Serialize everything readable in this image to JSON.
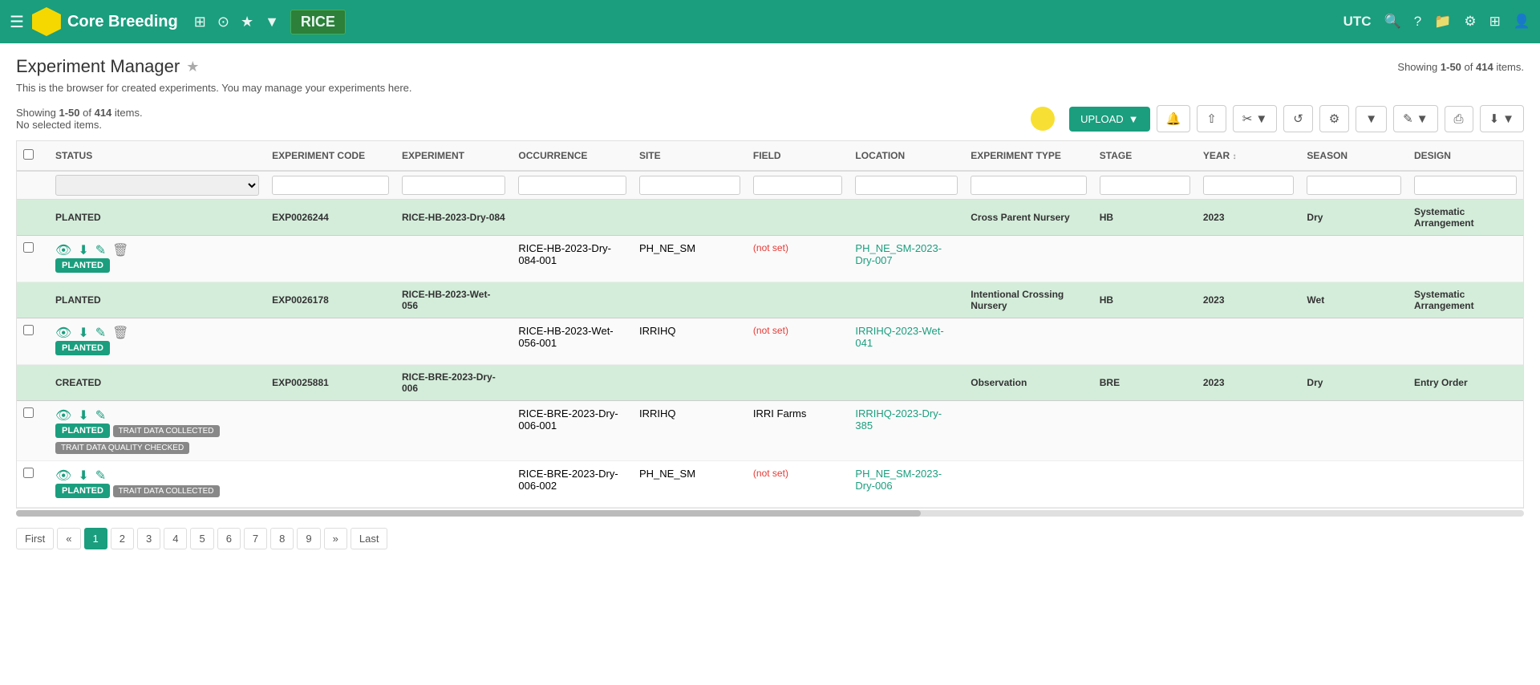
{
  "app": {
    "title": "Core Breeding",
    "filter_label": "RICE",
    "utc_label": "UTC"
  },
  "page": {
    "title": "Experiment Manager",
    "subtitle": "This is the browser for created experiments. You may manage your experiments here.",
    "subtitle_link": "here",
    "showing_text": "Showing",
    "showing_range": "1-50",
    "showing_of": "of",
    "showing_count": "414",
    "showing_items": "items.",
    "selected_items": "No selected items.",
    "showing_right": "Showing 1-50 of 414 items."
  },
  "toolbar": {
    "upload_label": "UPLOAD",
    "bell_icon": "🔔",
    "share_icon": "⇧",
    "tools_icon": "⚙",
    "refresh_icon": "↺",
    "settings_icon": "⚙",
    "filter_icon": "▼",
    "edit_icon": "✎",
    "print_icon": "⎙",
    "download_icon": "⬇"
  },
  "table": {
    "columns": [
      {
        "id": "checkbox",
        "label": ""
      },
      {
        "id": "status",
        "label": "STATUS"
      },
      {
        "id": "exp_code",
        "label": "EXPERIMENT CODE"
      },
      {
        "id": "experiment",
        "label": "EXPERIMENT"
      },
      {
        "id": "occurrence",
        "label": "OCCURRENCE"
      },
      {
        "id": "site",
        "label": "SITE"
      },
      {
        "id": "field",
        "label": "FIELD"
      },
      {
        "id": "location",
        "label": "LOCATION"
      },
      {
        "id": "exp_type",
        "label": "EXPERIMENT TYPE"
      },
      {
        "id": "stage",
        "label": "STAGE"
      },
      {
        "id": "year",
        "label": "YEAR"
      },
      {
        "id": "season",
        "label": "SEASON"
      },
      {
        "id": "design",
        "label": "DESIGN"
      }
    ],
    "groups": [
      {
        "status_label": "PLANTED",
        "exp_code": "EXP0026244",
        "experiment": "RICE-HB-2023-Dry-084",
        "exp_type": "Cross Parent Nursery",
        "stage": "HB",
        "year": "2023",
        "season": "Dry",
        "design": "Systematic Arrangement",
        "rows": [
          {
            "checkbox": false,
            "status": "PLANTED",
            "tags": [],
            "occurrence": "RICE-HB-2023-Dry-084-001",
            "site": "PH_NE_SM",
            "field": "(not set)",
            "location": "PH_NE_SM-2023-Dry-007",
            "has_delete": true
          }
        ]
      },
      {
        "status_label": "PLANTED",
        "exp_code": "EXP0026178",
        "experiment": "RICE-HB-2023-Wet-056",
        "exp_type": "Intentional Crossing Nursery",
        "stage": "HB",
        "year": "2023",
        "season": "Wet",
        "design": "Systematic Arrangement",
        "rows": [
          {
            "checkbox": false,
            "status": "PLANTED",
            "tags": [],
            "occurrence": "RICE-HB-2023-Wet-056-001",
            "site": "IRRIHQ",
            "field": "(not set)",
            "location": "IRRIHQ-2023-Wet-041",
            "has_delete": true
          }
        ]
      },
      {
        "status_label": "CREATED",
        "exp_code": "EXP0025881",
        "experiment": "RICE-BRE-2023-Dry-006",
        "exp_type": "Observation",
        "stage": "BRE",
        "year": "2023",
        "season": "Dry",
        "design": "Entry Order",
        "rows": [
          {
            "checkbox": false,
            "status": "PLANTED",
            "tags": [
              "TRAIT DATA COLLECTED",
              "TRAIT DATA QUALITY CHECKED"
            ],
            "occurrence": "RICE-BRE-2023-Dry-006-001",
            "site": "IRRIHQ",
            "field": "IRRI Farms",
            "location": "IRRIHQ-2023-Dry-385",
            "has_delete": false
          },
          {
            "checkbox": false,
            "status": "PLANTED",
            "tags": [
              "TRAIT DATA COLLECTED"
            ],
            "occurrence": "RICE-BRE-2023-Dry-006-002",
            "site": "PH_NE_SM",
            "field": "(not set)",
            "location": "PH_NE_SM-2023-Dry-006",
            "has_delete": false
          }
        ]
      }
    ]
  },
  "pagination": {
    "first": "First",
    "prev": "«",
    "pages": [
      "1",
      "2",
      "3",
      "4",
      "5",
      "6",
      "7",
      "8",
      "9"
    ],
    "active_page": "1",
    "next": "»",
    "last": "Last"
  }
}
